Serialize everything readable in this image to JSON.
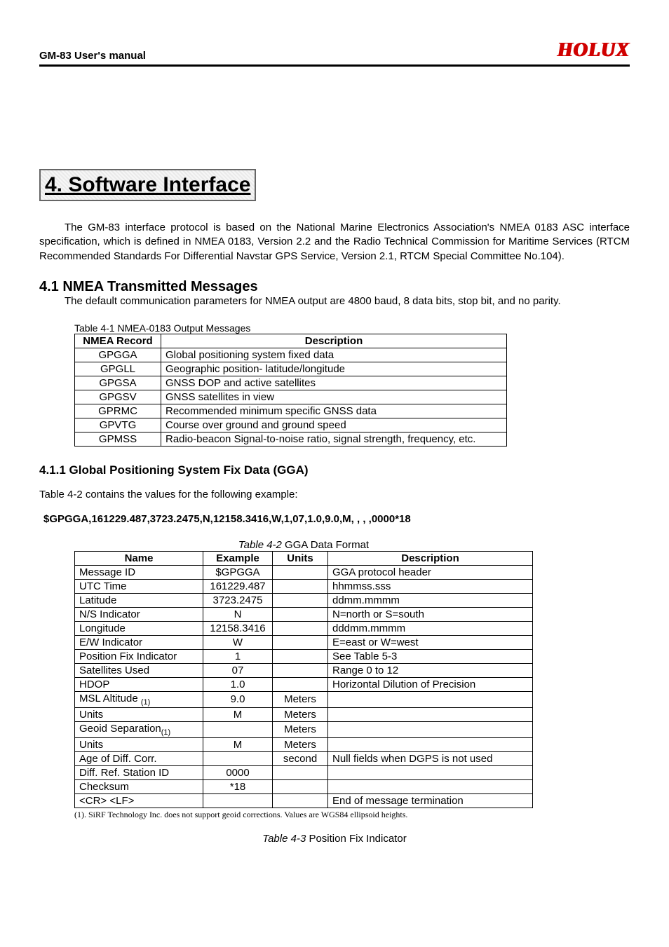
{
  "header": {
    "title": "GM-83 User's manual",
    "logo": "HOLUX"
  },
  "section_title": "4. Software Interface",
  "intro_paragraph": "The GM-83 interface protocol is based on the National Marine Electronics Association's NMEA 0183 ASC interface specification, which is defined in NMEA 0183, Version 2.2 and the Radio Technical Commission for Maritime Services (RTCM Recommended Standards For Differential Navstar GPS Service, Version 2.1, RTCM Special Committee No.104).",
  "h2_41": "4.1 NMEA Transmitted Messages",
  "p_41": "The default communication parameters for NMEA output are 4800 baud, 8 data bits, stop bit, and no parity.",
  "table41_caption": "Table 4-1 NMEA-0183 Output Messages",
  "table41_head": {
    "c1": "NMEA Record",
    "c2": "Description"
  },
  "table41_rows": [
    {
      "rec": "GPGGA",
      "desc": "Global positioning system fixed data"
    },
    {
      "rec": "GPGLL",
      "desc": "Geographic position- latitude/longitude"
    },
    {
      "rec": "GPGSA",
      "desc": "GNSS DOP and active satellites"
    },
    {
      "rec": "GPGSV",
      "desc": "GNSS satellites in view"
    },
    {
      "rec": "GPRMC",
      "desc": "Recommended minimum specific GNSS data"
    },
    {
      "rec": "GPVTG",
      "desc": "Course over ground and ground speed"
    },
    {
      "rec": "GPMSS",
      "desc": "Radio-beacon Signal-to-noise ratio, signal strength, frequency, etc."
    }
  ],
  "h3_411": "4.1.1 Global Positioning System Fix Data (GGA)",
  "p_411": "Table 4-2 contains the values for the following example:",
  "example_line": "$GPGGA,161229.487,3723.2475,N,12158.3416,W,1,07,1.0,9.0,M, , , ,0000*18",
  "table42_caption_prefix": "Table 4-2",
  "table42_caption_rest": " GGA Data Format",
  "table42_head": {
    "c1": "Name",
    "c2": "Example",
    "c3": "Units",
    "c4": "Description"
  },
  "table42_rows": [
    {
      "name": "Message ID",
      "ex": "$GPGGA",
      "unit": "",
      "desc": "GGA protocol header"
    },
    {
      "name": "UTC Time",
      "ex": "161229.487",
      "unit": "",
      "desc": "hhmmss.sss"
    },
    {
      "name": "Latitude",
      "ex": "3723.2475",
      "unit": "",
      "desc": "ddmm.mmmm"
    },
    {
      "name": "N/S Indicator",
      "ex": "N",
      "unit": "",
      "desc": "N=north or S=south"
    },
    {
      "name": "Longitude",
      "ex": "12158.3416",
      "unit": "",
      "desc": "dddmm.mmmm"
    },
    {
      "name": "E/W Indicator",
      "ex": "W",
      "unit": "",
      "desc": "E=east or W=west"
    },
    {
      "name": "Position Fix Indicator",
      "ex": "1",
      "unit": "",
      "desc": "See Table 5-3"
    },
    {
      "name": "Satellites Used",
      "ex": "07",
      "unit": "",
      "desc": "Range 0 to 12"
    },
    {
      "name": "HDOP",
      "ex": "1.0",
      "unit": "",
      "desc": "Horizontal Dilution of Precision"
    },
    {
      "name_html": "MSL Altitude <span class='sub1'>(1)</span>",
      "ex": "9.0",
      "unit": "Meters",
      "desc": ""
    },
    {
      "name": "Units",
      "ex": "M",
      "unit": "Meters",
      "desc": ""
    },
    {
      "name_html": "Geoid Separation<span class='sub1'>(1)</span>",
      "ex": "",
      "unit": "Meters",
      "desc": ""
    },
    {
      "name": "Units",
      "ex": "M",
      "unit": "Meters",
      "desc": ""
    },
    {
      "name": "Age of Diff. Corr.",
      "ex": "",
      "unit": "second",
      "desc": "Null fields when DGPS is not used"
    },
    {
      "name": "Diff. Ref. Station ID",
      "ex": "0000",
      "unit": "",
      "desc": ""
    },
    {
      "name": "Checksum",
      "ex": "*18",
      "unit": "",
      "desc": ""
    },
    {
      "name": "<CR> <LF>",
      "ex": "",
      "unit": "",
      "desc": "End of message termination"
    }
  ],
  "footnote": "(1). SiRF Technology Inc. does not support geoid corrections. Values are WGS84 ellipsoid heights.",
  "table43_caption_prefix": "Table 4-3",
  "table43_caption_rest": " Position Fix Indicator"
}
